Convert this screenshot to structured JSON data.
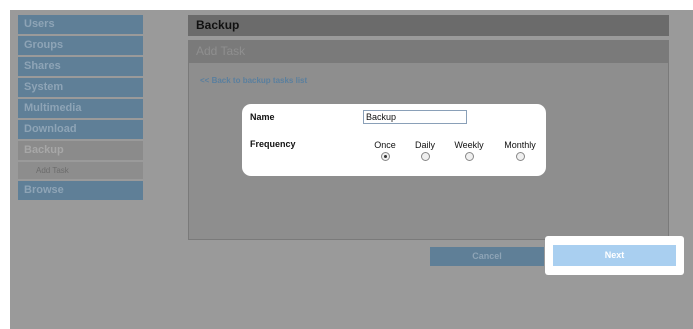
{
  "sidebar": {
    "items": [
      {
        "label": "Users"
      },
      {
        "label": "Groups"
      },
      {
        "label": "Shares"
      },
      {
        "label": "System"
      },
      {
        "label": "Multimedia"
      },
      {
        "label": "Download"
      },
      {
        "label": "Backup"
      },
      {
        "label": "Browse"
      }
    ],
    "active_sub": "Add Task"
  },
  "header": {
    "title": "Backup",
    "subtitle": "Add Task"
  },
  "back_link": "<< Back to backup tasks list",
  "form": {
    "name_label": "Name",
    "name_value": "Backup",
    "frequency_label": "Frequency",
    "options": [
      {
        "label": "Once",
        "checked": true
      },
      {
        "label": "Daily",
        "checked": false
      },
      {
        "label": "Weekly",
        "checked": false
      },
      {
        "label": "Monthly",
        "checked": false
      }
    ]
  },
  "buttons": {
    "cancel": "Cancel",
    "next": "Next"
  },
  "colors": {
    "accent": "#5f7f97",
    "next_button": "#a9cff0"
  }
}
